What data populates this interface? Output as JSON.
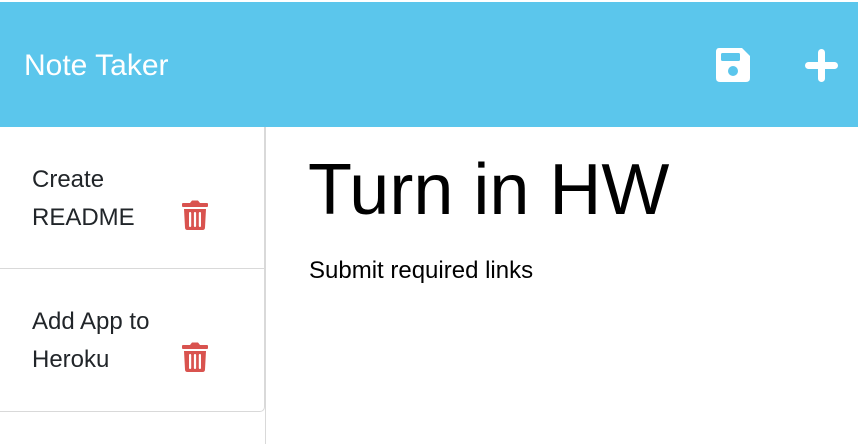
{
  "app": {
    "title": "Note Taker",
    "accent_color": "#5bc6ec",
    "delete_color": "#d9534f"
  },
  "toolbar": {
    "save_icon": "save-icon",
    "new_icon": "plus-icon"
  },
  "notes": [
    {
      "title": "Create README",
      "delete_icon": "trash-icon"
    },
    {
      "title": "Add App to Heroku",
      "delete_icon": "trash-icon"
    }
  ],
  "active_note": {
    "title": "Turn in HW",
    "text": "Submit required links"
  }
}
